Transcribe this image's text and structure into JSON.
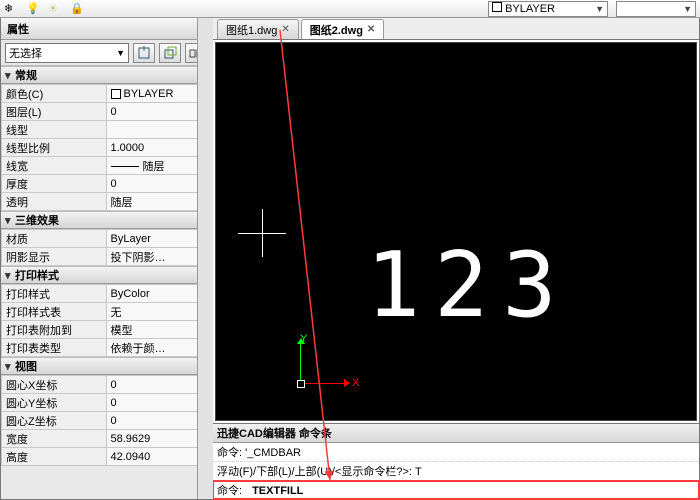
{
  "toolbar": {
    "bylayer_label": "BYLAYER"
  },
  "panel": {
    "title": "属性",
    "selection": "无选择",
    "groups": {
      "general": {
        "header": "常规",
        "rows": [
          {
            "k": "颜色(C)",
            "v": "BYLAYER",
            "swatch": true
          },
          {
            "k": "图层(L)",
            "v": "0"
          },
          {
            "k": "线型",
            "v": ""
          },
          {
            "k": "线型比例",
            "v": "1.0000"
          },
          {
            "k": "线宽",
            "v": "随层",
            "lw": true
          },
          {
            "k": "厚度",
            "v": "0"
          },
          {
            "k": "透明",
            "v": "随层"
          }
        ]
      },
      "threeD": {
        "header": "三维效果",
        "rows": [
          {
            "k": "材质",
            "v": "ByLayer"
          },
          {
            "k": "阴影显示",
            "v": "投下阴影…"
          }
        ]
      },
      "print": {
        "header": "打印样式",
        "rows": [
          {
            "k": "打印样式",
            "v": "ByColor"
          },
          {
            "k": "打印样式表",
            "v": "无"
          },
          {
            "k": "打印表附加到",
            "v": "模型"
          },
          {
            "k": "打印表类型",
            "v": "依赖于颜…"
          }
        ]
      },
      "view": {
        "header": "视图",
        "rows": [
          {
            "k": "圆心X坐标",
            "v": "0"
          },
          {
            "k": "圆心Y坐标",
            "v": "0"
          },
          {
            "k": "圆心Z坐标",
            "v": "0"
          },
          {
            "k": "宽度",
            "v": "58.9629"
          },
          {
            "k": "高度",
            "v": "42.0940"
          }
        ]
      }
    }
  },
  "tabs": [
    {
      "label": "图纸1.dwg",
      "active": false
    },
    {
      "label": "图纸2.dwg",
      "active": true
    }
  ],
  "canvas": {
    "digits": "123",
    "x_label": "X",
    "y_label": "Y"
  },
  "cmdbar": {
    "title": "迅捷CAD编辑器 命令条",
    "line1": "命令: '_CMDBAR",
    "line2": "浮动(F)/下部(L)/上部(U)/<显示命令栏?>: T",
    "prompt": "命令:",
    "input": "TEXTFILL"
  }
}
